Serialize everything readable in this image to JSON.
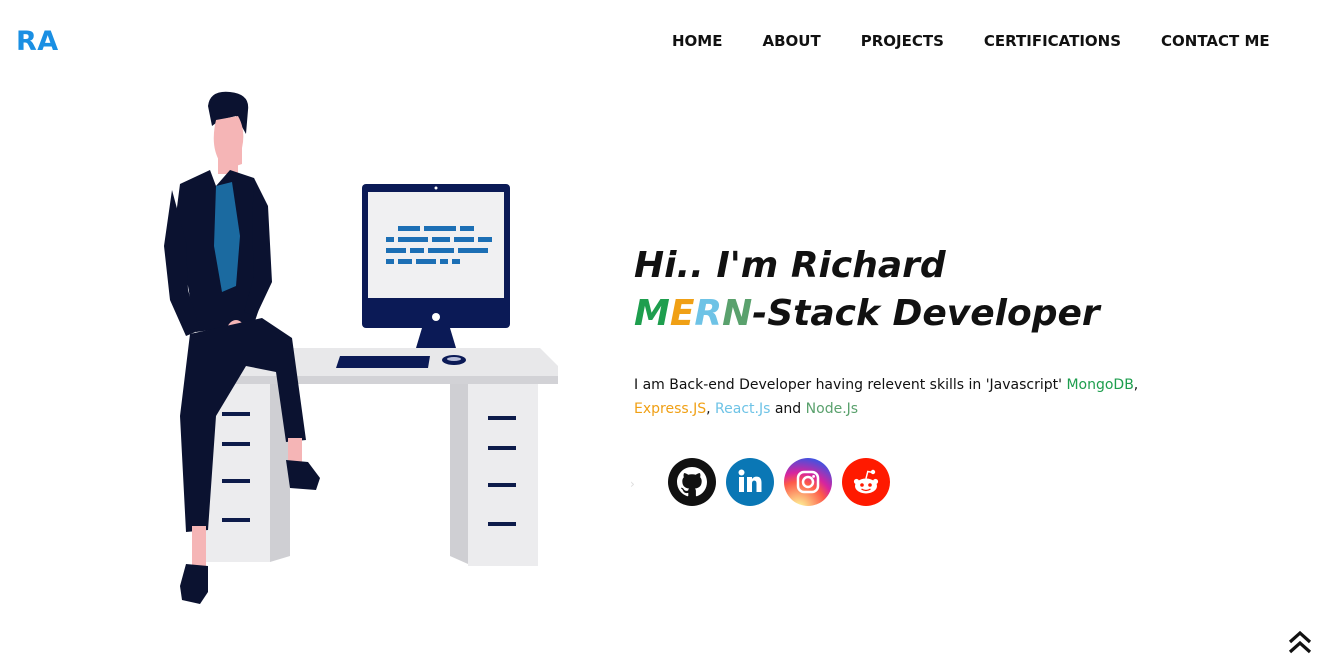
{
  "logo": {
    "text": "RA",
    "color": "#1a8fe3"
  },
  "nav": {
    "items": [
      {
        "label": "HOME"
      },
      {
        "label": "ABOUT"
      },
      {
        "label": "PROJECTS"
      },
      {
        "label": "CERTIFICATIONS"
      },
      {
        "label": "CONTACT ME"
      }
    ]
  },
  "hero": {
    "greeting": "Hi.. I'm Richard",
    "role_letters": [
      "M",
      "E",
      "R",
      "N"
    ],
    "role_suffix": "-Stack Developer",
    "description_prefix": "I am Back-end Developer having relevent skills in 'Javascript' ",
    "techs": {
      "mongo": "MongoDB",
      "express": "Express.JS",
      "react": "React.Js",
      "node": "Node.Js"
    },
    "sep_comma": ",",
    "sep_and": " and ",
    "colors": {
      "green": "#1e9e4e",
      "orange": "#f0a015",
      "lightblue": "#6ec3e6",
      "sage": "#5aa16d"
    }
  },
  "socials": [
    {
      "name": "github-icon",
      "bg": "#111111"
    },
    {
      "name": "linkedin-icon",
      "bg": "#0a77b5"
    },
    {
      "name": "instagram-icon",
      "bg": "#d6249f"
    },
    {
      "name": "reddit-icon",
      "bg": "#ff1a00"
    }
  ],
  "scroll_top": {
    "icon": "double-chevron-up-icon"
  }
}
